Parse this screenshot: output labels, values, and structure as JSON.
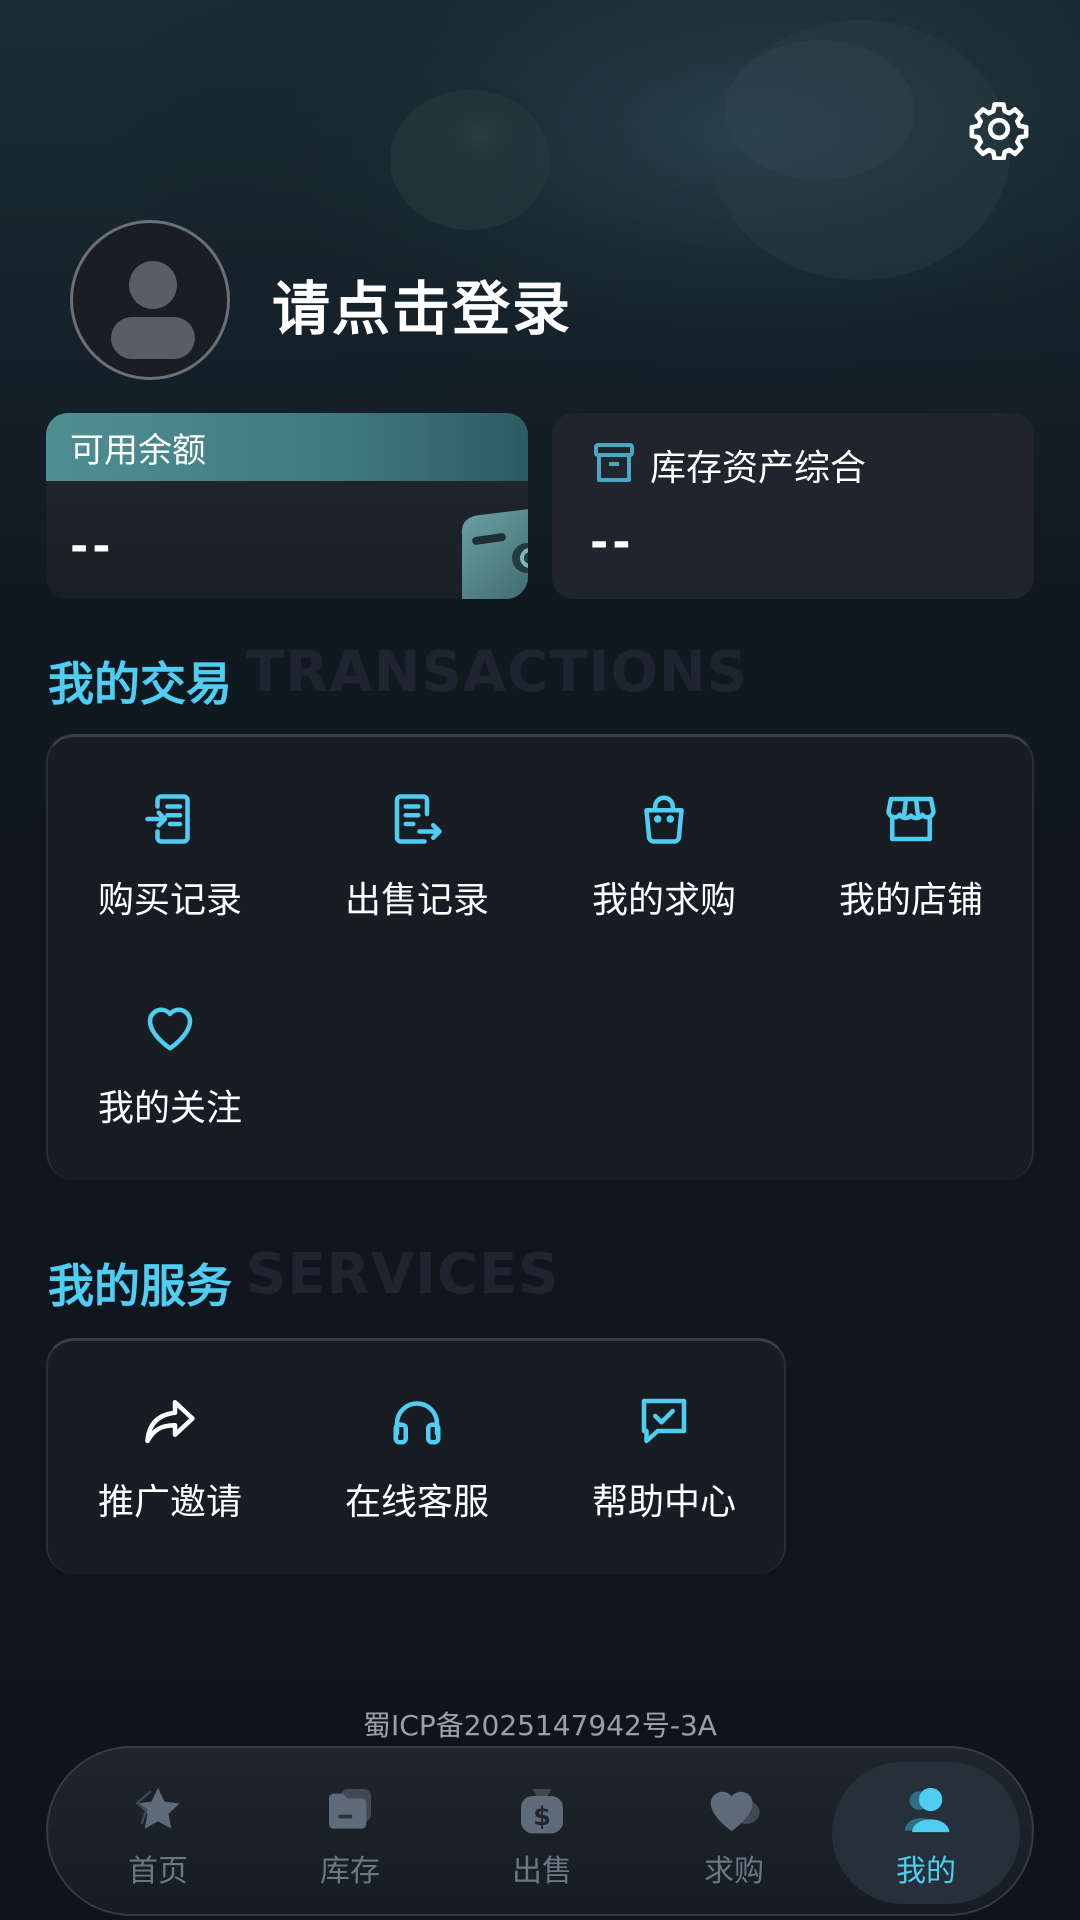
{
  "header": {
    "login_prompt": "请点击登录"
  },
  "balance_card": {
    "label": "可用余额",
    "value": "--"
  },
  "stock_card": {
    "label": "库存资产综合",
    "value": "--"
  },
  "transactions": {
    "title": "我的交易",
    "subtitle": "TRANSACTIONS",
    "items": [
      {
        "label": "购买记录",
        "icon": "buy-record-icon"
      },
      {
        "label": "出售记录",
        "icon": "sell-record-icon"
      },
      {
        "label": "我的求购",
        "icon": "shopping-bag-icon"
      },
      {
        "label": "我的店铺",
        "icon": "store-icon"
      },
      {
        "label": "我的关注",
        "icon": "heart-icon"
      }
    ]
  },
  "services": {
    "title": "我的服务",
    "subtitle": "SERVICES",
    "items": [
      {
        "label": "推广邀请",
        "icon": "share-icon"
      },
      {
        "label": "在线客服",
        "icon": "headphones-icon"
      },
      {
        "label": "帮助中心",
        "icon": "chat-check-icon"
      }
    ]
  },
  "footer": {
    "icp": "蜀ICP备2025147942号-3A"
  },
  "tabbar": {
    "items": [
      {
        "label": "首页",
        "icon": "star-icon",
        "active": false
      },
      {
        "label": "库存",
        "icon": "folder-icon",
        "active": false
      },
      {
        "label": "出售",
        "icon": "dollar-bag-icon",
        "active": false
      },
      {
        "label": "求购",
        "icon": "heart-icon",
        "active": false
      },
      {
        "label": "我的",
        "icon": "user-icon",
        "active": true
      }
    ]
  },
  "colors": {
    "accent": "#4fcdf2",
    "background": "#0f141a",
    "card": "#1f242d",
    "muted_tab": "#6c7784"
  }
}
